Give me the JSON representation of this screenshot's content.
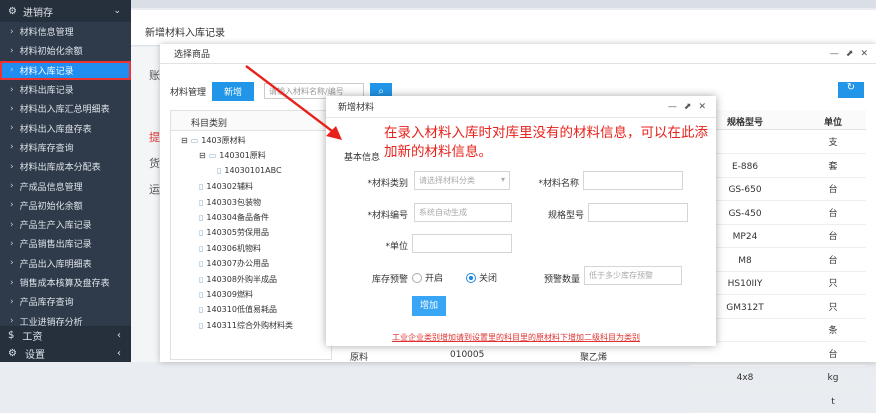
{
  "sidebar": {
    "section": "进销存",
    "items": [
      "材料信息管理",
      "材料初始化余额",
      "材料入库记录",
      "材料出库记录",
      "材料出入库汇总明细表",
      "材料出入库盘存表",
      "材料库存查询",
      "材料出库成本分配表",
      "产成品信息管理",
      "产品初始化余额",
      "产品生产入库记录",
      "产品销售出库记录",
      "产品出入库明细表",
      "销售成本核算及盘存表",
      "产品库存查询",
      "工业进销存分析"
    ],
    "active_index": 2,
    "footer": [
      "工资",
      "设置"
    ],
    "footer_icons": [
      "$",
      "gear-icon"
    ]
  },
  "page": {
    "title": "新增材料入库记录",
    "left_labels": [
      "账",
      "提",
      "货",
      "运"
    ]
  },
  "outer_modal": {
    "title": "选择商品",
    "toolbar_label": "材料管理",
    "add_button": "新增",
    "search_placeholder": "请输入材料名称/编号",
    "tree_header": "科目类别",
    "tree": [
      {
        "text": "1403原材料",
        "level": 0
      },
      {
        "text": "140301原料",
        "level": 1
      },
      {
        "text": "14030101ABC",
        "level": 2
      },
      {
        "text": "140302辅料",
        "level": 1
      },
      {
        "text": "140303包装物",
        "level": 1
      },
      {
        "text": "140304备品备件",
        "level": 1
      },
      {
        "text": "140305劳保用品",
        "level": 1
      },
      {
        "text": "140306机物料",
        "level": 1
      },
      {
        "text": "140307办公用品",
        "level": 1
      },
      {
        "text": "140308外购半成品",
        "level": 1
      },
      {
        "text": "140309燃料",
        "level": 1
      },
      {
        "text": "140310低值易耗品",
        "level": 1
      },
      {
        "text": "140311综合外购材料类",
        "level": 1
      }
    ],
    "columns": [
      "规格型号",
      "单位"
    ],
    "rows": [
      [
        "",
        "支"
      ],
      [
        "E-886",
        "套"
      ],
      [
        "GS-650",
        "台"
      ],
      [
        "GS-450",
        "台"
      ],
      [
        "MP24",
        "台"
      ],
      [
        "M8",
        "台"
      ],
      [
        "HS10IIY",
        "只"
      ],
      [
        "GM312T",
        "只"
      ],
      [
        "",
        "条"
      ],
      [
        "",
        "台"
      ],
      [
        "4x8",
        "kg"
      ],
      [
        "",
        "t"
      ]
    ],
    "bottom_row": [
      "原料",
      "010005",
      "聚乙烯"
    ]
  },
  "inner_modal": {
    "title": "新增材料",
    "section": "基本信息",
    "fields": {
      "category_label": "*材料类别",
      "category_placeholder": "请选择材料分类",
      "name_label": "*材料名称",
      "code_label": "*材料编号",
      "code_placeholder": "系统自动生成",
      "spec_label": "规格型号",
      "unit_label": "*单位",
      "warn_label": "库存预警",
      "on": "开启",
      "off": "关闭",
      "qty_label": "预警数量",
      "qty_placeholder": "低于多少库存预警"
    },
    "submit": "增加",
    "hint": "工业企业类别增加请到设置里的科目里的原材料下增加二级科目为类别"
  },
  "annotation": "在录入材料入库时对库里没有的材料信息，可以在此添加新的材料信息。",
  "colors": {
    "sidebar": "#2f3a4a",
    "accent": "#2196e8",
    "annotation": "#e8211b"
  }
}
